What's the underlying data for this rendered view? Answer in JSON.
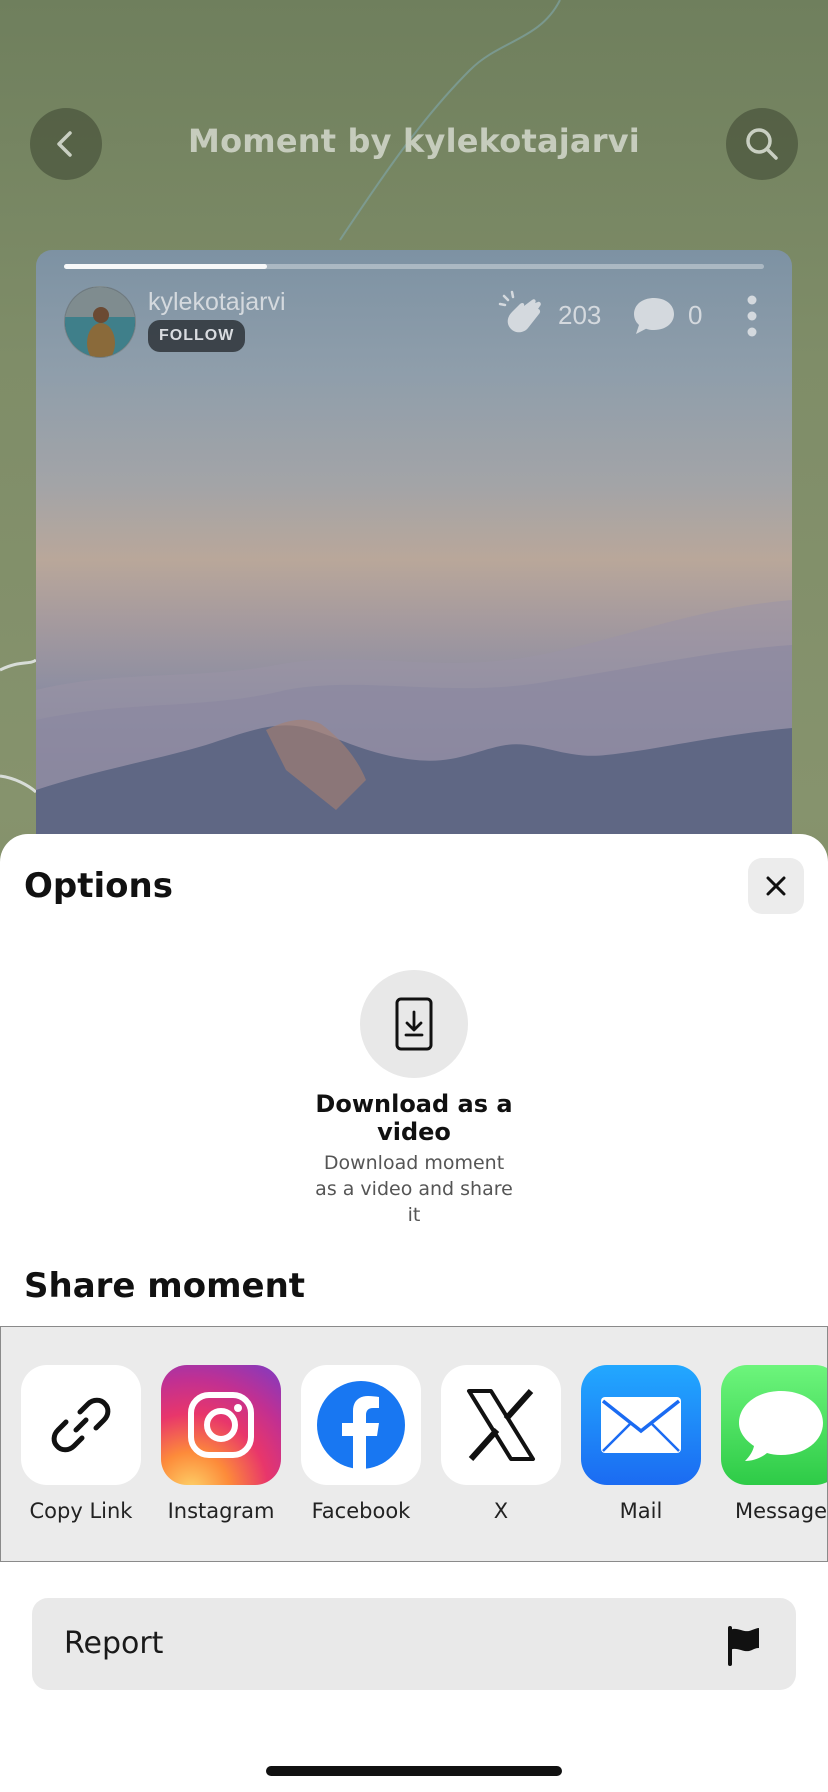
{
  "header": {
    "title": "Moment by kylekotajarvi",
    "back_icon": "chevron-left-icon",
    "search_icon": "search-icon"
  },
  "moment": {
    "username": "kylekotajarvi",
    "follow_label": "FOLLOW",
    "claps": "203",
    "comments": "0",
    "progress_fraction": 0.29
  },
  "sheet": {
    "title": "Options",
    "close_icon": "close-icon",
    "download": {
      "title": "Download as a video",
      "description": "Download moment as a video and share it"
    },
    "share_title": "Share moment",
    "share_targets": [
      {
        "label": "Copy Link",
        "icon": "link-icon"
      },
      {
        "label": "Instagram",
        "icon": "instagram-icon"
      },
      {
        "label": "Facebook",
        "icon": "facebook-icon"
      },
      {
        "label": "X",
        "icon": "x-icon"
      },
      {
        "label": "Mail",
        "icon": "mail-icon"
      },
      {
        "label": "Message",
        "icon": "message-icon"
      }
    ],
    "report_label": "Report"
  },
  "colors": {
    "facebook": "#1877f2",
    "mail": "#1b6bf2",
    "messages": "#2ecb47"
  }
}
